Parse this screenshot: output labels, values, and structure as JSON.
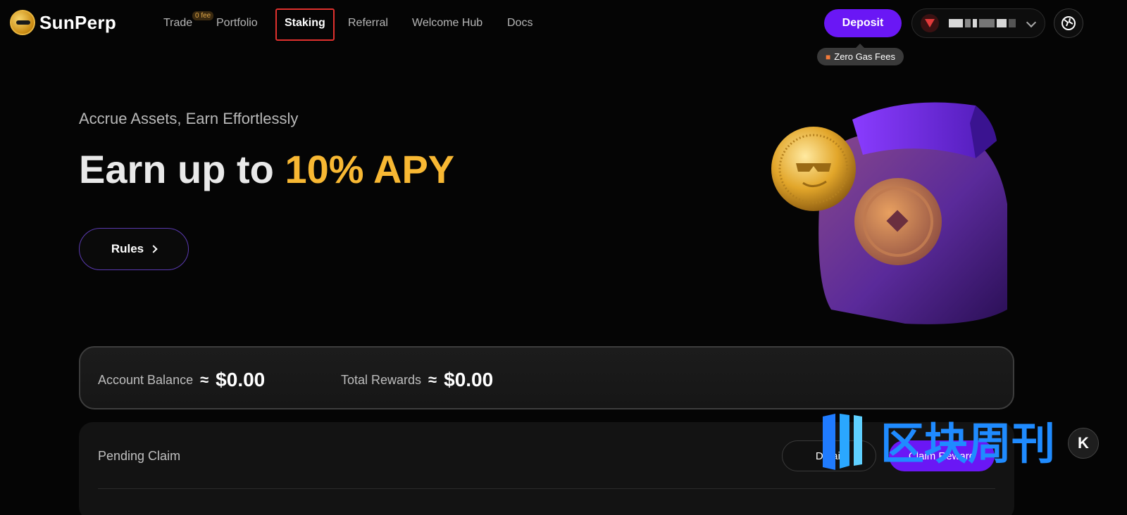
{
  "brand": {
    "name": "SunPerp"
  },
  "nav": {
    "items": [
      {
        "label": "Trade"
      },
      {
        "label": "Portfolio"
      },
      {
        "label": "Staking"
      },
      {
        "label": "Referral"
      },
      {
        "label": "Welcome Hub"
      },
      {
        "label": "Docs"
      }
    ],
    "trade_badge": "0 fee",
    "active": "Staking"
  },
  "header": {
    "deposit_label": "Deposit",
    "zero_gas_label": "Zero Gas Fees"
  },
  "hero": {
    "subtitle": "Accrue Assets, Earn Effortlessly",
    "title_lead": "Earn up to",
    "title_accent": "10% APY",
    "rules_label": "Rules"
  },
  "balance": {
    "account_label": "Account Balance",
    "account_approx": "≈",
    "account_value": "$0.00",
    "rewards_label": "Total Rewards",
    "rewards_approx": "≈",
    "rewards_value": "$0.00"
  },
  "pending": {
    "title": "Pending Claim",
    "detail_label": "Detail",
    "claim_label": "Claim Reward"
  },
  "watermark": {
    "text": "区块周刊",
    "mark": "K"
  },
  "colors": {
    "accent_purple": "#6a17f5",
    "apy_gold": "#f8b833",
    "highlight_red": "#e0312e"
  }
}
